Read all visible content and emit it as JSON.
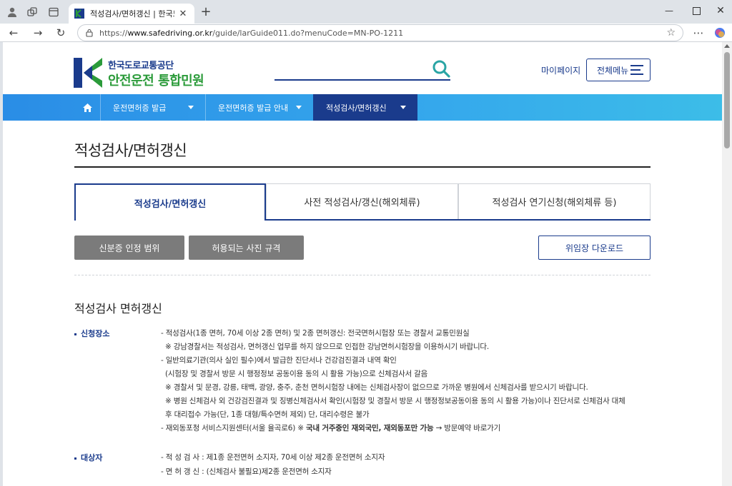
{
  "browser": {
    "tab_title": "적성검사/면허갱신 | 한국도로교통공단",
    "url_prefix": "https://",
    "url_host": "www.safedriving.or.kr",
    "url_path": "/guide/larGuide011.do?menuCode=MN-PO-1211"
  },
  "header": {
    "logo_line1": "한국도로교통공단",
    "logo_line2": "안전운전 통합민원",
    "mypage": "마이페이지",
    "allmenu": "전체메뉴"
  },
  "gnb": {
    "items": [
      "운전면허증 발급",
      "운전면허증 발급 안내",
      "적성검사/면허갱신"
    ]
  },
  "page": {
    "title": "적성검사/면허갱신",
    "tabs": [
      "적성검사/면허갱신",
      "사전 적성검사/갱신(해외체류)",
      "적성검사 연기신청(해외체류 등)"
    ],
    "buttons": {
      "id_range": "신분증 인정 범위",
      "photo_spec": "허용되는 사진 규격",
      "proxy_download": "위임장 다운로드"
    },
    "section_title": "적성검사 면허갱신",
    "place": {
      "label": "신청장소",
      "lines": [
        "- 적성검사(1종 면허, 70세 이상 2종 면허) 및 2종 면허갱신: 전국면허시험장 또는 경찰서 교통민원실",
        "※ 강남경찰서는 적성검사, 면허갱신 업무를 하지 않으므로 인접한 강남면허시험장을 이용하시기 바랍니다.",
        "- 일반의료기관(의사 실인 필수)에서 발급한 진단서나 건강검진결과 내역 확인",
        "(시험장 및 경찰서 방문 시 행정정보 공동이용 동의 시 활용 가능)으로 신체검사서 갈음",
        "※ 경찰서 및 문경, 강릉, 태백, 광양, 충주, 춘천 면허시험장 내에는 신체검사장이 없으므로 가까운 병원에서 신체검사를 받으시기 바랍니다.",
        "※ 병원 신체검사 외 건강검진결과 및 징병신체검사서 확인(시험장 및 경찰서 방문 시 행정정보공동이용 동의 시 활용 가능)이나 진단서로 신체검사 대체",
        "후 대리접수 가능(단, 1종 대형/특수면허 제외) 단, 대리수령은 불가"
      ],
      "last_line_a": "- 재외동포청 서비스지원센터(서울 율곡로6) ※",
      "last_line_b": "국내 거주중인 재외국민, 재외동포만 가능",
      "last_line_c": "→ 방문예약 바로가기"
    },
    "target": {
      "label": "대상자",
      "lines": [
        "- 적 성 검 사 : 제1종 운전면허 소지자, 70세 이상 제2종 운전면허 소지자",
        "- 면 허 갱 신 : (신체검사 불필요)제2종 운전면허 소지자"
      ]
    }
  }
}
